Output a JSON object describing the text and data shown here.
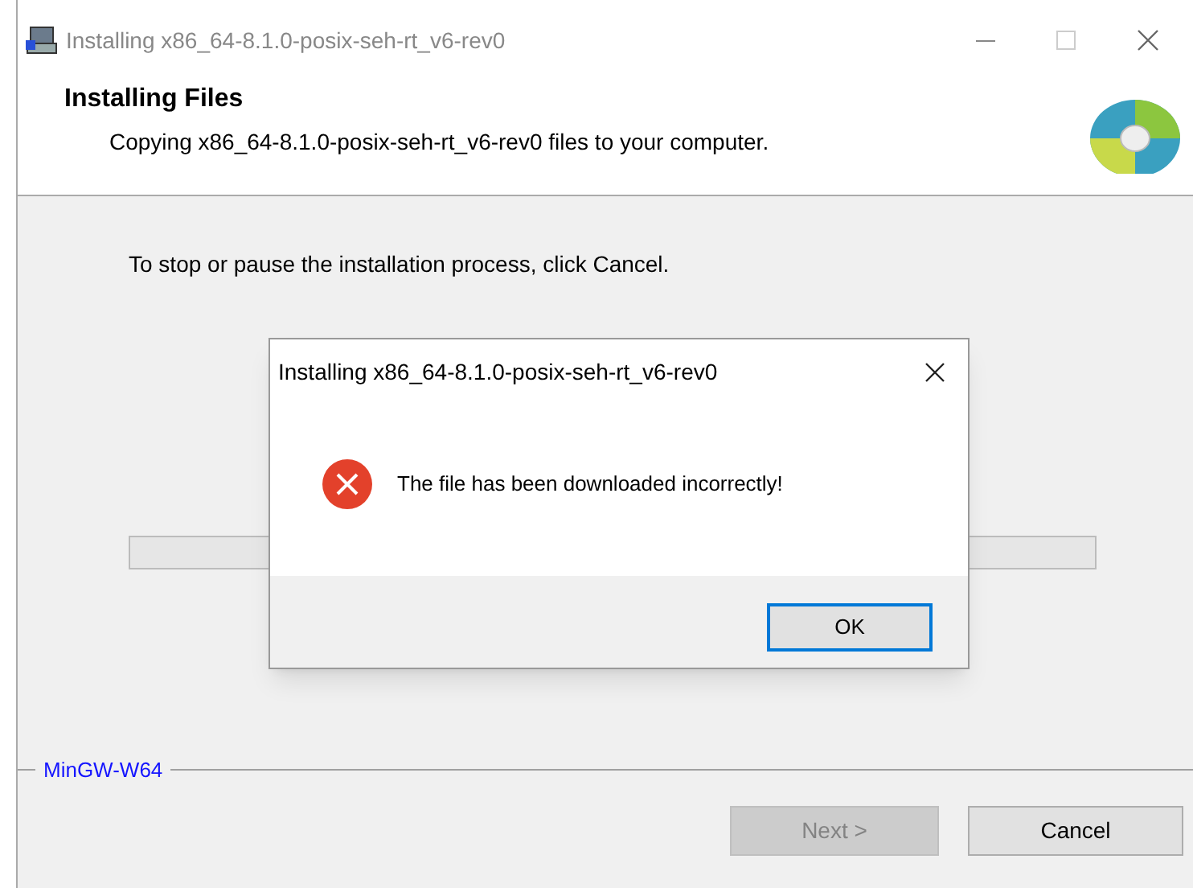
{
  "window": {
    "title": "Installing x86_64-8.1.0-posix-seh-rt_v6-rev0"
  },
  "header": {
    "title": "Installing Files",
    "subtitle": "Copying x86_64-8.1.0-posix-seh-rt_v6-rev0 files to your computer."
  },
  "body": {
    "instruction": "To stop or pause the installation process, click Cancel."
  },
  "brand": "MinGW-W64",
  "buttons": [
    {
      "label": "Next >",
      "disabled": true
    },
    {
      "label": "Cancel",
      "disabled": false
    }
  ],
  "dialog": {
    "title": "Installing x86_64-8.1.0-posix-seh-rt_v6-rev0",
    "message": "The file has been downloaded incorrectly!",
    "buttons": [
      {
        "label": "OK",
        "selected": true
      }
    ]
  }
}
